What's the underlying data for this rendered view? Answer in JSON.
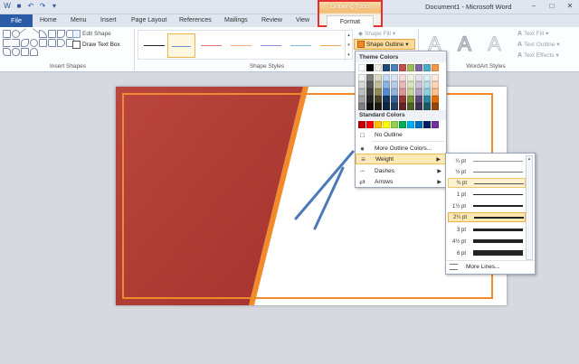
{
  "title_bar": {
    "document_title": "Document1 - Microsoft Word",
    "qat_icons": [
      "save-icon",
      "undo-icon",
      "redo-icon",
      "customize-icon"
    ]
  },
  "context_tab": {
    "group_label": "Drawing Tools",
    "tab_label": "Format",
    "highlight_color": "#e53030"
  },
  "tabs": [
    "File",
    "Home",
    "Menu",
    "Insert",
    "Page Layout",
    "References",
    "Mailings",
    "Review",
    "View"
  ],
  "ribbon": {
    "insert_shapes": {
      "edit_shape": "Edit Shape",
      "draw_text_box": "Draw Text Box",
      "label": "Insert Shapes"
    },
    "shape_styles": {
      "label": "Shape Styles",
      "shape_fill": "Shape Fill",
      "shape_outline": "Shape Outline",
      "line_colors": [
        "#222222",
        "#6f90c8",
        "#e57a7a",
        "#f2ad7a",
        "#8e8ee0",
        "#7fb8d2",
        "#f2a45a"
      ]
    },
    "wordart": {
      "label": "WordArt Styles",
      "text_fill": "Text Fill",
      "text_outline": "Text Outline",
      "text_effects": "Text Effects"
    }
  },
  "outline_menu": {
    "theme_colors_label": "Theme Colors",
    "theme_top_row": [
      "#ffffff",
      "#000000",
      "#eeece1",
      "#1f497d",
      "#4f81bd",
      "#c0504d",
      "#9bbb59",
      "#8064a2",
      "#4bacc6",
      "#f79646"
    ],
    "theme_shades": [
      [
        "#f2f2f2",
        "#7f7f7f",
        "#ddd9c3",
        "#c6d9f0",
        "#dbe5f1",
        "#f2dcdb",
        "#ebf1dd",
        "#e5e0ec",
        "#dbeef3",
        "#fdeada"
      ],
      [
        "#d8d8d8",
        "#595959",
        "#c4bd97",
        "#8db3e2",
        "#b8cce4",
        "#e5b9b7",
        "#d7e3bc",
        "#ccc1d9",
        "#b7dde8",
        "#fbd5b5"
      ],
      [
        "#bfbfbf",
        "#3f3f3f",
        "#938953",
        "#548dd4",
        "#95b3d7",
        "#d99694",
        "#c3d69b",
        "#b2a2c7",
        "#92cddc",
        "#fac08f"
      ],
      [
        "#a5a5a5",
        "#262626",
        "#494429",
        "#17365d",
        "#366092",
        "#953734",
        "#76923c",
        "#5f497a",
        "#31859b",
        "#e36c09"
      ],
      [
        "#7f7f7f",
        "#0c0c0c",
        "#1d1b10",
        "#0f243e",
        "#244061",
        "#632423",
        "#4f6128",
        "#3f3151",
        "#205867",
        "#974806"
      ]
    ],
    "standard_colors_label": "Standard Colors",
    "standard_colors": [
      "#c00000",
      "#ff0000",
      "#ffc000",
      "#ffff00",
      "#92d050",
      "#00b050",
      "#00b0f0",
      "#0070c0",
      "#002060",
      "#7030a0"
    ],
    "no_outline": "No Outline",
    "more_outline_colors": "More Outline Colors...",
    "weight": "Weight",
    "dashes": "Dashes",
    "arrows": "Arrows"
  },
  "weight_menu": {
    "items": [
      "¼ pt",
      "½ pt",
      "¾ pt",
      "1 pt",
      "1½ pt",
      "2¼ pt",
      "3 pt",
      "4½ pt",
      "6 pt"
    ],
    "selected": "2¼ pt",
    "more_lines": "More Lines..."
  },
  "slide": {
    "accent_colors": [
      "#a5322c",
      "#f08a2a",
      "#4c79b8"
    ]
  }
}
